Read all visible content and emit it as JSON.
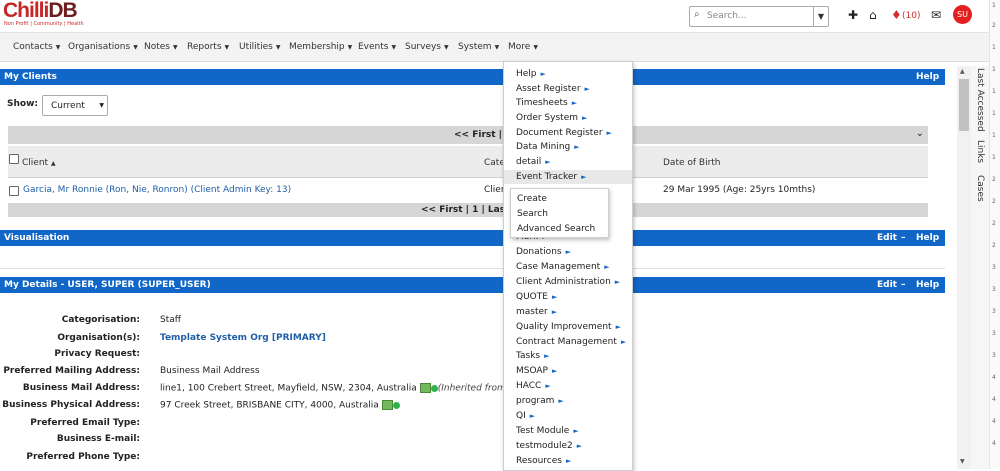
{
  "header": {
    "logo_text_a": "Chilli",
    "logo_text_b": "DB",
    "logo_tagline": "Non Profit | Community | Health",
    "search_placeholder": "Search...",
    "notification_count": "(10)",
    "avatar_initials": "SU"
  },
  "nav": {
    "items": [
      "Contacts",
      "Organisations",
      "Notes",
      "Reports",
      "Utilities",
      "Membership",
      "Events",
      "Surveys",
      "System",
      "More"
    ]
  },
  "my_clients": {
    "title": "My Clients",
    "help": "Help",
    "show_label": "Show:",
    "show_value": "Current",
    "pager_top": "<< First | 1 |",
    "pager_bottom": "<< First | 1 | Last >",
    "columns": [
      "Client",
      "Cate",
      "Date of Birth"
    ],
    "rows": [
      {
        "client": "Garcia, Mr Ronnie (Ron, Nie, Ronron) (Client Admin Key: 13)",
        "category": "Clien",
        "dob": "29 Mar 1995 (Age: 25yrs 10mths)"
      }
    ]
  },
  "visualisation": {
    "title": "Visualisation",
    "edit": "Edit",
    "dash": "–",
    "help": "Help"
  },
  "my_details": {
    "title": "My Details - USER, SUPER (SUPER_USER)",
    "edit": "Edit",
    "dash": "–",
    "help": "Help",
    "fields": [
      {
        "label": "Categorisation:",
        "value": "Staff"
      },
      {
        "label": "Organisation(s):",
        "value": "Template System Org [PRIMARY]"
      },
      {
        "label": "Privacy Request:",
        "value": ""
      },
      {
        "label": "Preferred Mailing Address:",
        "value": "Business Mail Address"
      },
      {
        "label": "Business Mail Address:",
        "value": "line1, 100 Crebert Street, Mayfield, NSW, 2304, Australia",
        "extra": "(Inherited from F"
      },
      {
        "label": "Business Physical Address:",
        "value": "97 Creek Street, BRISBANE CITY, 4000, Australia"
      },
      {
        "label": "Preferred Email Type:",
        "value": ""
      },
      {
        "label": "Business E-mail:",
        "value": ""
      },
      {
        "label": "Preferred Phone Type:",
        "value": ""
      }
    ]
  },
  "more_menu": {
    "items": [
      "Help",
      "Asset Register",
      "Timesheets",
      "Order System",
      "Document Register",
      "Data Mining",
      "detail",
      "Event Tracker",
      "",
      "",
      "",
      "Mark",
      "Donations",
      "Case Management",
      "Client Administration",
      "QUOTE",
      "master",
      "Quality Improvement",
      "Contract Management",
      "Tasks",
      "MSOAP",
      "HACC",
      "program",
      "QI",
      "Test Module",
      "testmodule2",
      "Resources"
    ],
    "active_index": 7
  },
  "event_submenu": {
    "items": [
      "Create",
      "Search",
      "Advanced Search"
    ]
  },
  "side_tabs": [
    "Last Accessed",
    "Links",
    "Cases"
  ],
  "ruler_marks": [
    "1",
    "2",
    "1",
    "1",
    "1",
    "1",
    "1",
    "1",
    "2",
    "2",
    "2",
    "2",
    "3",
    "3",
    "3",
    "3",
    "3",
    "4",
    "4",
    "4",
    "4"
  ]
}
